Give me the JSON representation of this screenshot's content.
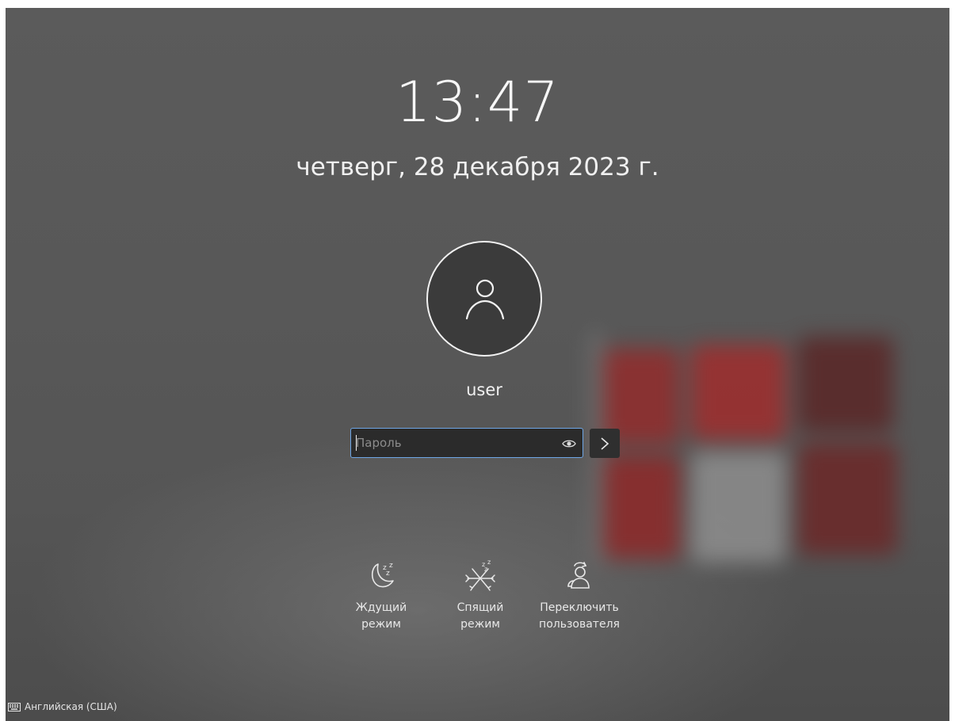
{
  "clock": {
    "time": "13:47",
    "date": "четверг, 28 декабря 2023 г."
  },
  "user": {
    "name": "user",
    "avatar_icon": "user-icon"
  },
  "login": {
    "password_placeholder": "Пароль",
    "password_value": "",
    "show_password_icon": "eye-icon",
    "submit_icon": "chevron-right-icon",
    "focus_color": "#6ea6e6"
  },
  "actions": [
    {
      "label": "Ждущий\nрежим",
      "icon": "moon-sleep-icon"
    },
    {
      "label": "Спящий\nрежим",
      "icon": "snowflake-sleep-icon"
    },
    {
      "label": "Переключить\nпользователя",
      "icon": "switch-user-icon"
    }
  ],
  "keyboard_layout": {
    "label": "Английская (США)",
    "icon": "keyboard-icon"
  }
}
